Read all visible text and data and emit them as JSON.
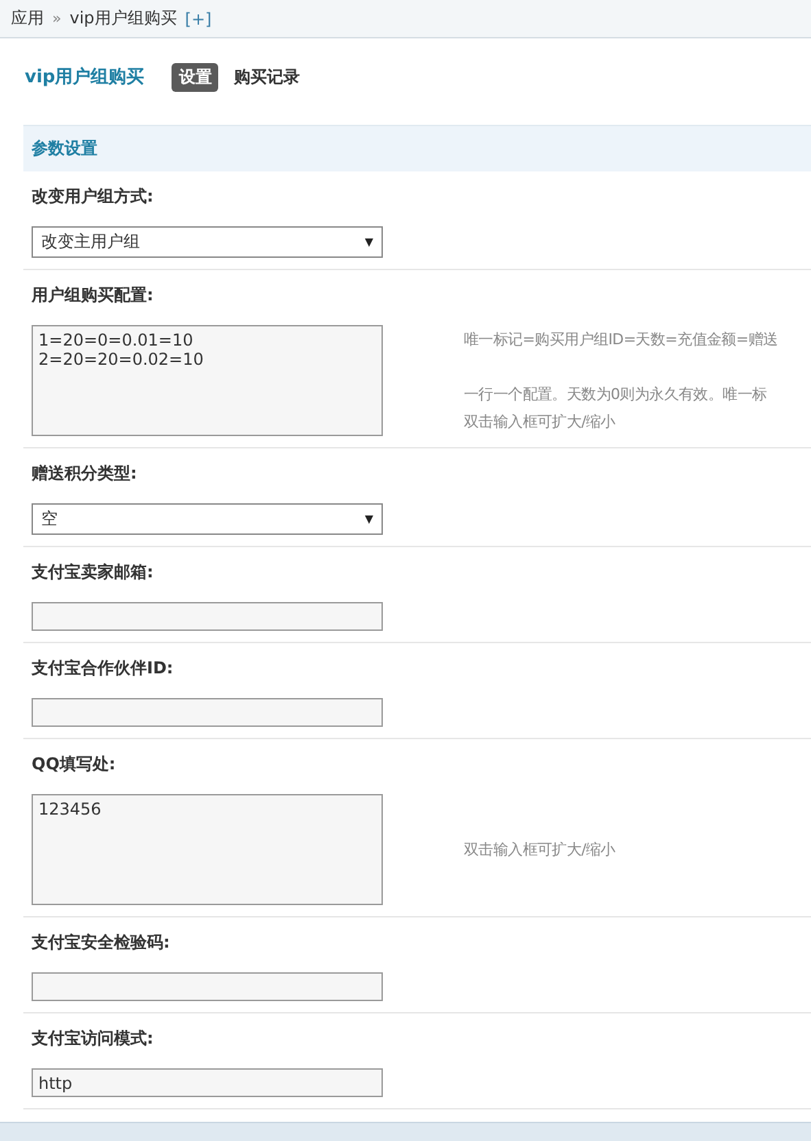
{
  "breadcrumb": {
    "items": [
      "应用",
      "vip用户组购买"
    ],
    "separator": "»",
    "action": "[+]"
  },
  "title": "vip用户组购买",
  "tabs": [
    {
      "label": "设置",
      "selected": true
    },
    {
      "label": "购买记录",
      "selected": false
    }
  ],
  "section": {
    "title": "参数设置"
  },
  "fields": [
    {
      "label": "改变用户组方式:",
      "kind": "select",
      "value": "改变主用户组",
      "arrow": "▼"
    },
    {
      "label": "用户组购买配置:",
      "kind": "textarea",
      "value": "1=20=0=0.01=10\n2=20=20=0.02=10",
      "help": [
        [
          "唯一标记=购买用户组ID=天数=充值金额=赠送"
        ],
        [
          "一行一个配置。天数为0则为永久有效。唯一标",
          "双击输入框可扩大/缩小"
        ]
      ]
    },
    {
      "label": "赠送积分类型:",
      "kind": "select",
      "value": "空",
      "arrow": "▼"
    },
    {
      "label": "支付宝卖家邮箱:",
      "kind": "input"
    },
    {
      "label": "支付宝合作伙伴ID:",
      "kind": "input"
    },
    {
      "label": "QQ填写处:",
      "kind": "textarea",
      "value": "123456",
      "help": [
        [
          "双击输入框可扩大/缩小"
        ]
      ]
    },
    {
      "label": "支付宝安全检验码:",
      "kind": "input"
    },
    {
      "label": "支付宝访问模式:",
      "kind": "input",
      "value": "http"
    }
  ]
}
